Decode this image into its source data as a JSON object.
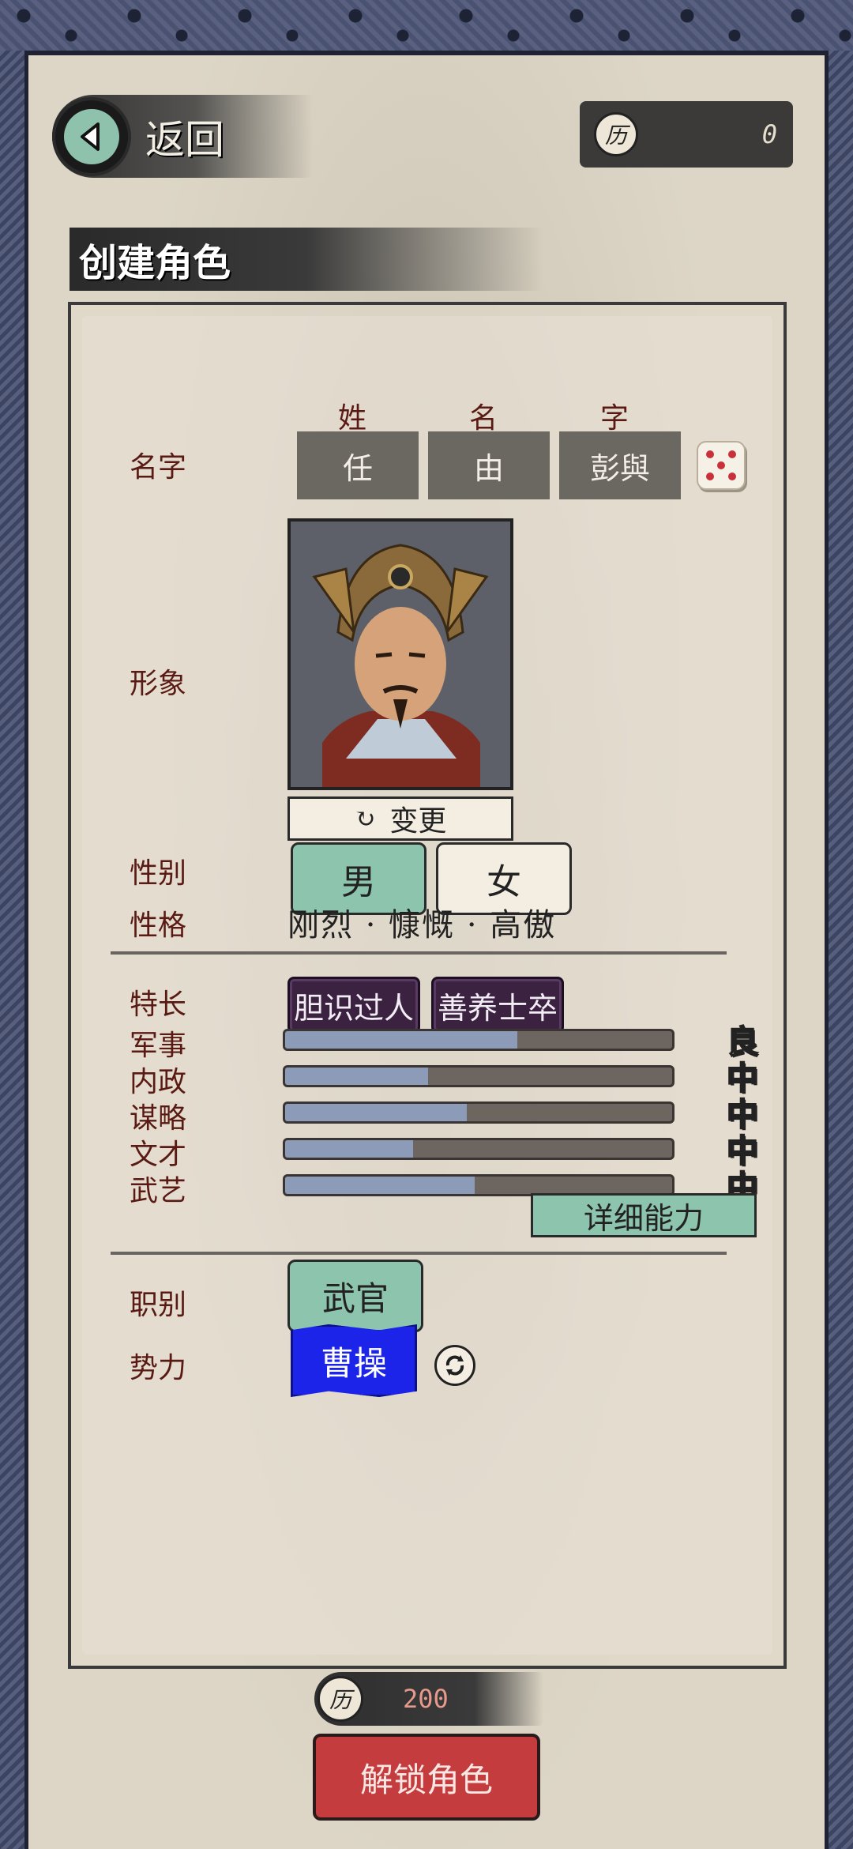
{
  "header": {
    "back_label": "返回",
    "currency_symbol": "历",
    "currency_value": "0",
    "page_title": "创建角色"
  },
  "form": {
    "name_label": "名字",
    "name_heads": [
      "姓",
      "名",
      "字"
    ],
    "name_values": [
      "任",
      "由",
      "彭與"
    ],
    "portrait_label": "形象",
    "change_label": "变更",
    "gender_label": "性别",
    "gender_options": [
      "男",
      "女"
    ],
    "gender_selected": "男",
    "personality_label": "性格",
    "personality_value": "刚烈 · 慷慨 · 高傲",
    "specialty_label": "特长",
    "specialties": [
      "胆识过人",
      "善养士卒"
    ],
    "stats": [
      {
        "label": "军事",
        "value": 0.6,
        "grade": "良"
      },
      {
        "label": "内政",
        "value": 0.37,
        "grade": "中"
      },
      {
        "label": "谋略",
        "value": 0.47,
        "grade": "中"
      },
      {
        "label": "文才",
        "value": 0.33,
        "grade": "中"
      },
      {
        "label": "武艺",
        "value": 0.49,
        "grade": "中"
      }
    ],
    "detail_label": "详细能力",
    "role_label": "职别",
    "role_value": "武官",
    "faction_label": "势力",
    "faction_value": "曹操"
  },
  "footer": {
    "cost_symbol": "历",
    "cost_value": "200",
    "unlock_label": "解锁角色"
  },
  "colors": {
    "accent_green": "#8cc4ad",
    "specialty_purple": "#3a2240",
    "faction_blue": "#1b24e8",
    "unlock_red": "#c43c3e",
    "good_grade": "#f5e86a"
  },
  "icons": [
    "back-arrow-icon",
    "coin-icon",
    "dice-icon",
    "refresh-icon"
  ]
}
